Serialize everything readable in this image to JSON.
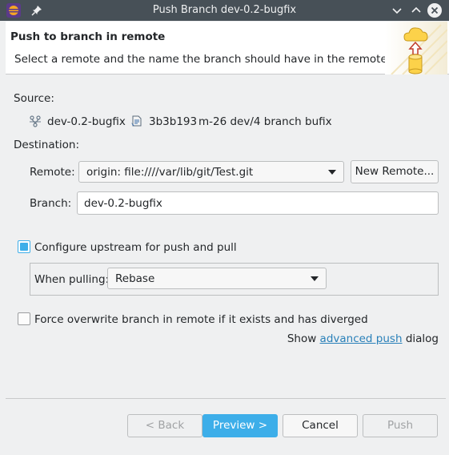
{
  "window": {
    "title": "Push Branch dev-0.2-bugfix"
  },
  "header": {
    "title": "Push to branch in remote",
    "description": "Select a remote and the name the branch should have in the remote."
  },
  "source": {
    "label": "Source:",
    "branch": "dev-0.2-bugfix",
    "commit_id": "3b3b193",
    "commit_message": "m-26 dev/4 branch bufix"
  },
  "destination": {
    "label": "Destination:",
    "remote_label": "Remote:",
    "remote_value": "origin: file:////var/lib/git/Test.git",
    "new_remote_label": "New Remote...",
    "branch_label": "Branch:",
    "branch_value": "dev-0.2-bugfix"
  },
  "upstream": {
    "label": "Configure upstream for push and pull",
    "checked": true,
    "when_pulling_label": "When pulling:",
    "when_pulling_value": "Rebase"
  },
  "force": {
    "label": "Force overwrite branch in remote if it exists and has diverged",
    "checked": false
  },
  "advanced": {
    "prefix": "Show",
    "link": "advanced push",
    "suffix": "dialog"
  },
  "buttons": {
    "back": "< Back",
    "preview": "Preview >",
    "cancel": "Cancel",
    "push": "Push"
  },
  "colors": {
    "accent": "#3daee9",
    "titlebar": "#475057",
    "link": "#2980b9"
  }
}
